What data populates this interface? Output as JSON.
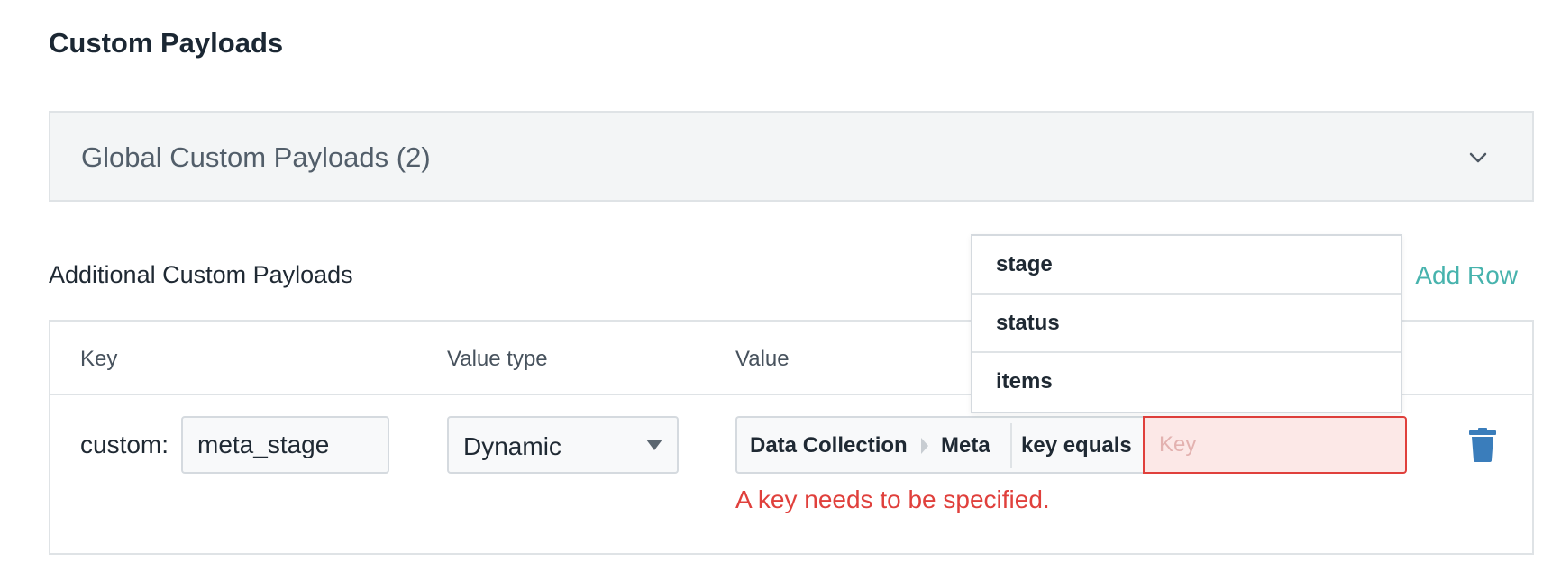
{
  "page": {
    "title": "Custom Payloads"
  },
  "global_section": {
    "label": "Global Custom Payloads (2)",
    "icon": "chevron-down-icon"
  },
  "additional_section": {
    "title": "Additional Custom Payloads",
    "add_row_label": "Add Row"
  },
  "table": {
    "headers": [
      "Key",
      "Value type",
      "Value"
    ],
    "rows": [
      {
        "key_prefix": "custom:",
        "key_value": "meta_stage",
        "value_type": "Dynamic",
        "value_path": [
          "Data Collection",
          "Meta"
        ],
        "operator": "key equals",
        "key_placeholder": "Key",
        "key_value_input": "",
        "error": "A key needs to be specified.",
        "delete_icon": "trash-icon"
      }
    ]
  },
  "dropdown": {
    "options": [
      "stage",
      "status",
      "items"
    ]
  },
  "colors": {
    "accent": "#47b3ad",
    "error": "#e0403c",
    "trash": "#3a7dbb",
    "panel_bg": "#f3f5f6"
  }
}
